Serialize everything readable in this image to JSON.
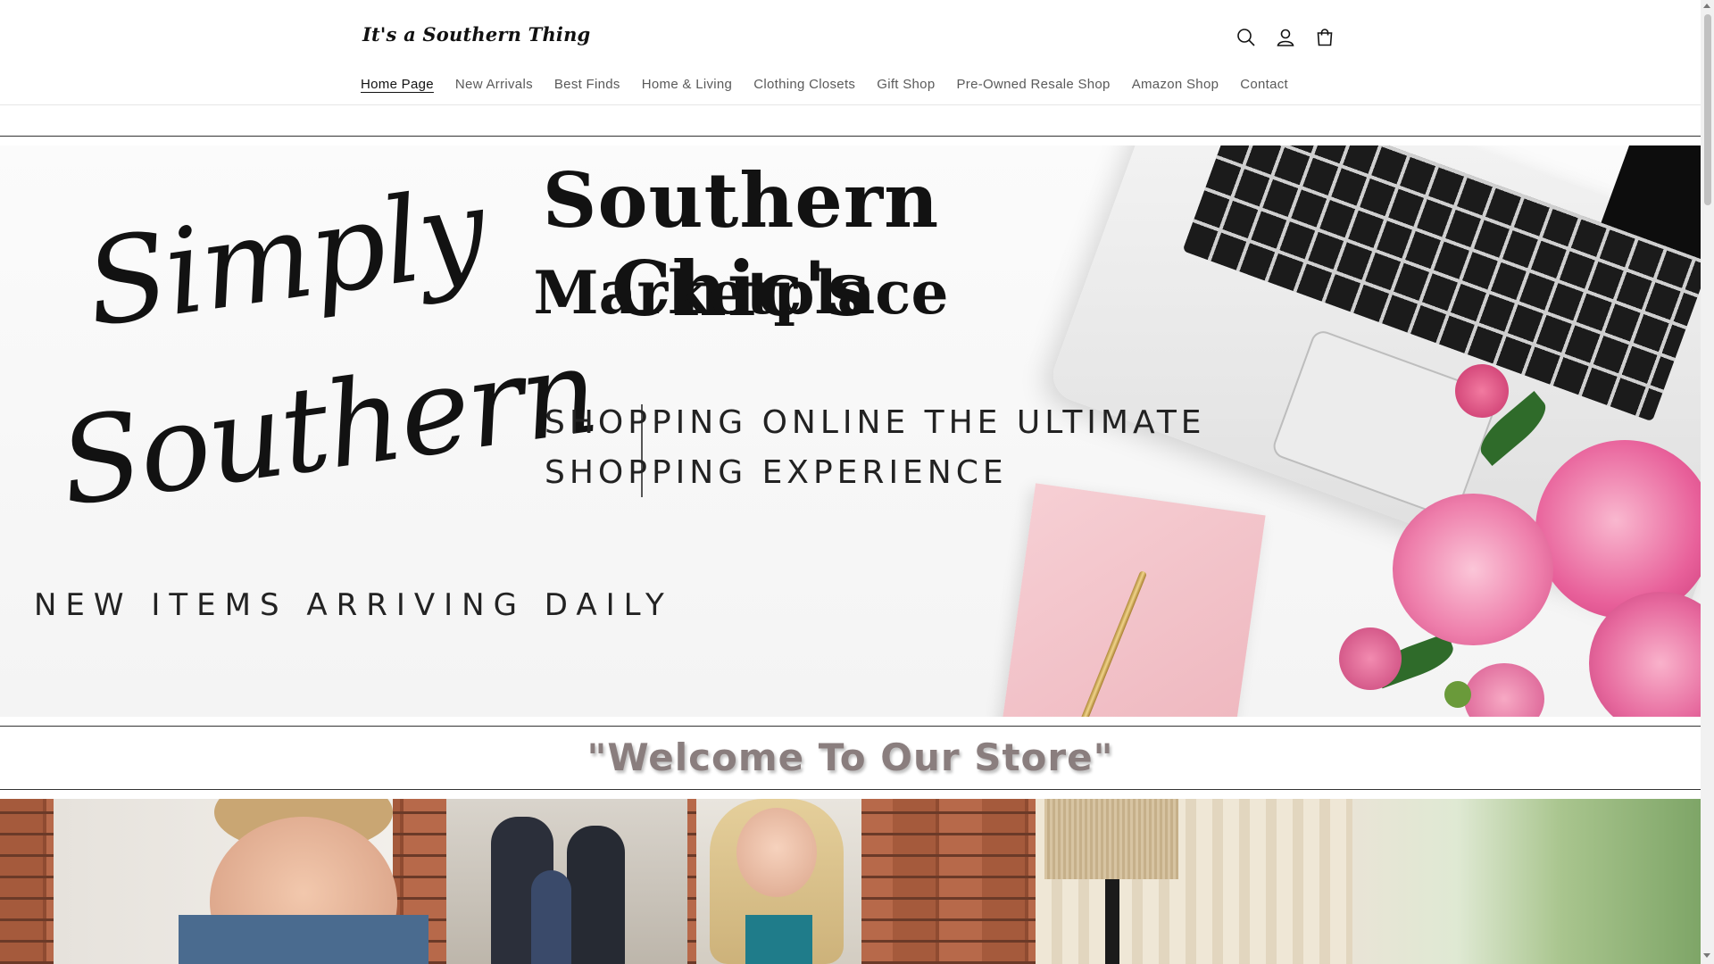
{
  "header": {
    "logo_text": "It's a Southern Thing",
    "icons": [
      "search-icon",
      "account-icon",
      "cart-icon"
    ]
  },
  "nav": {
    "items": [
      {
        "label": "Home Page",
        "active": true
      },
      {
        "label": "New Arrivals",
        "active": false
      },
      {
        "label": "Best Finds",
        "active": false
      },
      {
        "label": "Home & Living",
        "active": false
      },
      {
        "label": "Clothing Closets",
        "active": false
      },
      {
        "label": "Gift Shop",
        "active": false
      },
      {
        "label": "Pre-Owned Resale Shop",
        "active": false
      },
      {
        "label": "Amazon Shop",
        "active": false
      },
      {
        "label": "Contact",
        "active": false
      }
    ]
  },
  "hero": {
    "script_line1": "Simply",
    "script_line2": "Southern",
    "title": "Southern Chic's",
    "subtitle": "Marketplace",
    "tagline_line1": "SHOPPING ONLINE THE ULTIMATE",
    "tagline_line2": "SHOPPING EXPERIENCE",
    "arriving": "NEW ITEMS ARRIVING DAILY"
  },
  "welcome": {
    "text": "\"Welcome To Our Store\""
  },
  "colors": {
    "welcome_text": "#8a7e7e",
    "nav_inactive": "#5a5a5a",
    "nav_active": "#121212"
  }
}
